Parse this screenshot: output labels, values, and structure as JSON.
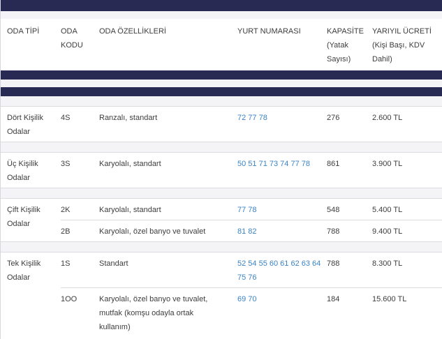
{
  "headers": {
    "room_type": "ODA TİPİ",
    "room_code_1": "ODA",
    "room_code_2": "KODU",
    "features": "ODA ÖZELLİKLERİ",
    "dorm_numbers": "YURT NUMARASI",
    "capacity_1": "KAPASİTE",
    "capacity_2": "(Yatak",
    "capacity_3": "Sayısı)",
    "fee_1": "YARIYIL ÜCRETİ",
    "fee_2": "(Kişi Başı, KDV",
    "fee_3": "Dahil)"
  },
  "groups": [
    {
      "type_1": "Dört Kişilik",
      "type_2": "Odalar",
      "rows": [
        {
          "code": "4S",
          "features": "Ranzalı, standart",
          "dorms_1": "72 77 78",
          "dorms_2": "",
          "capacity": "276",
          "fee": "2.600 TL"
        }
      ]
    },
    {
      "type_1": "Üç Kişilik",
      "type_2": "Odalar",
      "rows": [
        {
          "code": "3S",
          "features": "Karyolalı, standart",
          "dorms_1": "50 51 71 73 74 77 78",
          "dorms_2": "",
          "capacity": "861",
          "fee": "3.900 TL"
        }
      ]
    },
    {
      "type_1": "Çift Kişilik",
      "type_2": "Odalar",
      "rows": [
        {
          "code": "2K",
          "features": "Karyolalı, standart",
          "dorms_1": "77 78",
          "dorms_2": "",
          "capacity": "548",
          "fee": "5.400 TL"
        },
        {
          "code": "2B",
          "features": "Karyolalı, özel banyo ve tuvalet",
          "dorms_1": "81 82",
          "dorms_2": "",
          "capacity": "788",
          "fee": "9.400 TL"
        }
      ]
    },
    {
      "type_1": "Tek Kişilik",
      "type_2": "Odalar",
      "rows": [
        {
          "code": "1S",
          "features": "Standart",
          "dorms_1": "52 54 55 60 61 62 63 64",
          "dorms_2": "75 76",
          "capacity": "788",
          "fee": "8.300 TL"
        },
        {
          "code": "1OO",
          "features_1": "Karyolalı, özel banyo ve tuvalet,",
          "features_2": "mutfak (komşu odayla ortak",
          "features_3": "kullanım)",
          "dorms_1": "69 70",
          "dorms_2": "",
          "capacity": "184",
          "fee": "15.600 TL"
        }
      ]
    }
  ],
  "colors": {
    "navy": "#282a53",
    "link": "#3a83c4",
    "stripe": "#f4f4f6"
  }
}
